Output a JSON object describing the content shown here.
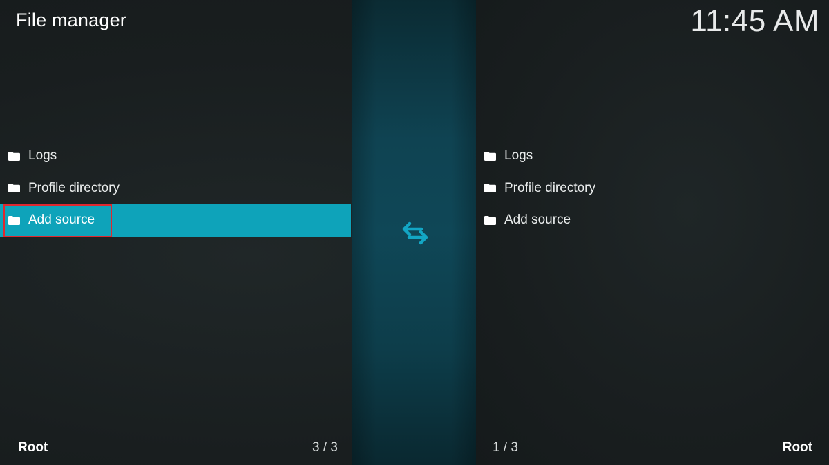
{
  "header": {
    "title": "File manager",
    "clock": "11:45 AM"
  },
  "left_pane": {
    "items": [
      {
        "label": "Logs",
        "icon": "folder-icon"
      },
      {
        "label": "Profile directory",
        "icon": "folder-icon"
      },
      {
        "label": "Add source",
        "icon": "folder-icon",
        "selected": true
      }
    ],
    "footer_label": "Root",
    "footer_count": "3 / 3"
  },
  "right_pane": {
    "items": [
      {
        "label": "Logs",
        "icon": "folder-icon"
      },
      {
        "label": "Profile directory",
        "icon": "folder-icon"
      },
      {
        "label": "Add source",
        "icon": "folder-icon"
      }
    ],
    "footer_label": "Root",
    "footer_count": "1 / 3"
  },
  "center": {
    "icon": "swap-arrows-icon"
  },
  "colors": {
    "accent": "#0ea3ba",
    "highlight_border": "#e0282f",
    "divider": "#0f4757"
  }
}
